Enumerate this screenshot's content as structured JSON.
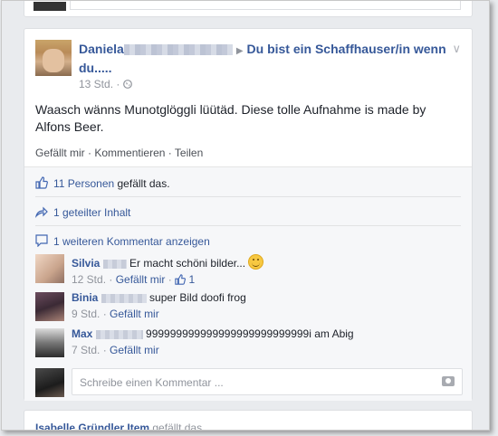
{
  "post": {
    "author_name": "Daniela",
    "group_name": "Du bist ein Schaffhauser/in wenn du.....",
    "time": "13 Std.",
    "text": "Waasch wänns Munotglöggli lüütäd. Diese tolle Aufnahme is made by Alfons Beer.",
    "actions": {
      "like": "Gefällt mir",
      "comment": "Kommentieren",
      "share": "Teilen"
    }
  },
  "ufi": {
    "likes_link": "11 Personen",
    "likes_suffix": " gefällt das.",
    "shares_link": "1 geteilter Inhalt",
    "more_comments_link": "1 weiteren Kommentar anzeigen",
    "comments": [
      {
        "name": "Silvia",
        "text": "Er macht schöni bilder...",
        "time": "12 Std.",
        "like_label": "Gefällt mir",
        "like_count": "1"
      },
      {
        "name": "Binia",
        "text": "super Bild doofi frog",
        "time": "9 Std.",
        "like_label": "Gefällt mir"
      },
      {
        "name": "Max",
        "text": "999999999999999999999999999i am Abig",
        "time": "7 Std.",
        "like_label": "Gefällt mir"
      }
    ],
    "composer_placeholder": "Schreibe einen Kommentar ..."
  },
  "next_card": {
    "name": "Isabelle Gründler Item",
    "suffix": " gefällt das."
  },
  "icons": {
    "dropdown": "chevron-down-icon",
    "globe": "globe-icon",
    "like": "thumbs-up-icon",
    "share": "share-arrow-icon",
    "comment": "speech-bubble-icon",
    "camera": "camera-icon"
  },
  "colors": {
    "link": "#365899",
    "meta": "#90949c",
    "background": "#e9ebee"
  }
}
